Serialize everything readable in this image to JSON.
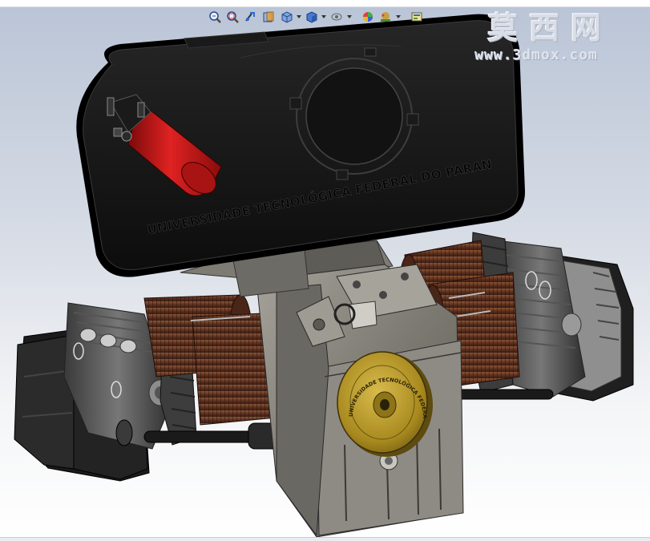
{
  "app": {
    "view_toolbar": {
      "icons": [
        "zoom-to-fit-icon",
        "zoom-to-area-icon",
        "previous-view-icon",
        "section-view-icon",
        "view-orientation-icon",
        "display-style-icon",
        "hide-show-items-icon",
        "edit-appearance-icon",
        "apply-scene-icon",
        "view-settings-icon"
      ]
    }
  },
  "watermark": {
    "brand": "莫西网",
    "url": "www.3dmox.com"
  },
  "model": {
    "cover_text": "UNIVERSIDADE TECNOLÓGICA FEDERAL DO PARANÁ",
    "flywheel_text": "UNIVERSIDADE TECNOLÓGICA FEDERAL DO PARANÁ",
    "colors": {
      "cover": "#161616",
      "coil_red": "#c81818",
      "copper": "#6a3a24",
      "metal": "#8b8880",
      "flywheel_gold": "#b89a2c"
    }
  }
}
